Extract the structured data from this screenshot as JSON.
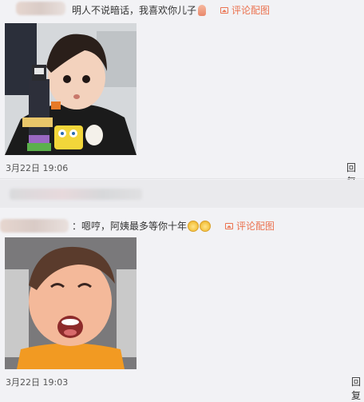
{
  "comments": [
    {
      "text": "明人不说暗话，我喜欢你儿子",
      "emoji": "hand-emoji",
      "pic_link": "评论配图",
      "timestamp": "3月22日 19:06",
      "reply": "回复"
    },
    {
      "text": "：嗯哼，阿姨最多等你十年",
      "emoji": "cat-face-emoji",
      "pic_link": "评论配图",
      "timestamp": "3月22日 19:03",
      "reply": "回复"
    }
  ],
  "colors": {
    "background": "#f2f2f5",
    "link": "#eb7350",
    "text": "#333333",
    "meta": "#555555"
  }
}
